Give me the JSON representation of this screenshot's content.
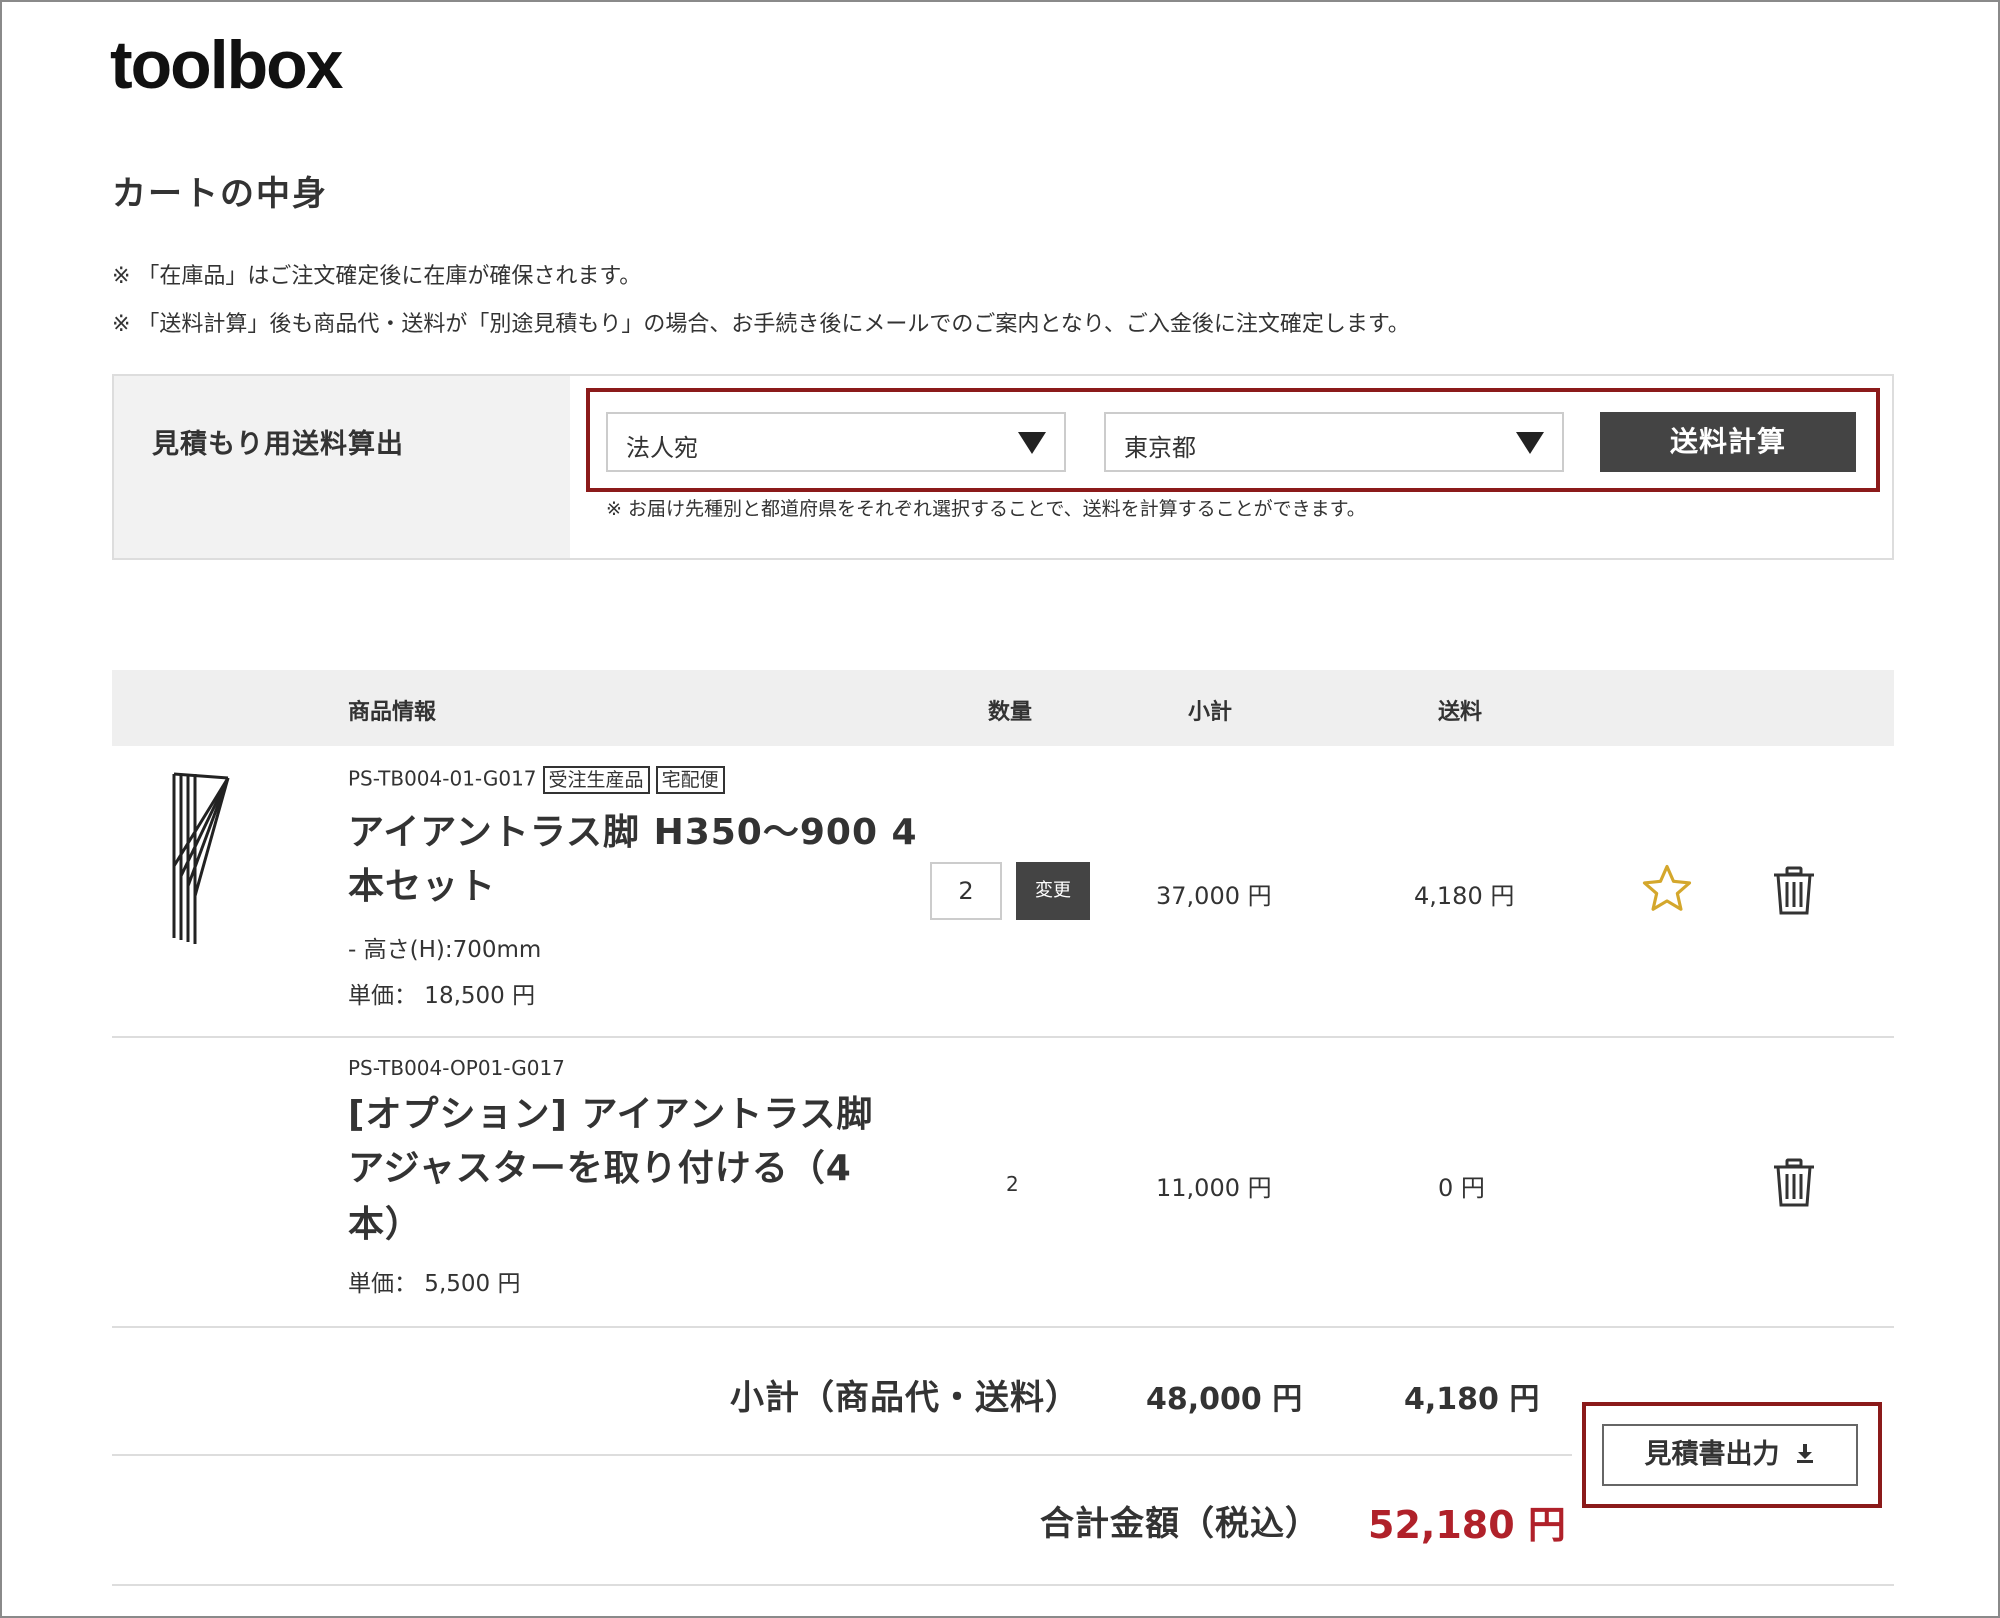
{
  "header": {
    "logo": "toolbox"
  },
  "page": {
    "title": "カートの中身",
    "notes": [
      "※ 「在庫品」はご注文確定後に在庫が確保されます。",
      "※ 「送料計算」後も商品代・送料が「別途見積もり」の場合、お手続き後にメールでのご案内となり、ご入金後に注文確定します。"
    ]
  },
  "shipping": {
    "label": "見積もり用送料算出",
    "destination_type": "法人宛",
    "prefecture": "東京都",
    "calc_button": "送料計算",
    "note": "※ お届け先種別と都道府県をそれぞれ選択することで、送料を計算することができます。"
  },
  "table": {
    "headers": {
      "product": "商品情報",
      "qty": "数量",
      "subtotal": "小計",
      "shipping": "送料"
    }
  },
  "items": [
    {
      "sku": "PS-TB004-01-G017",
      "tags": [
        "受注生産品",
        "宅配便"
      ],
      "name_line1": "アイアントラス脚 H350〜900 4",
      "name_line2": "本セット",
      "option": "-  高さ(H):700mm",
      "unit_price": "単価： 18,500 円",
      "qty": "2",
      "change_label": "変更",
      "subtotal": "37,000 円",
      "shipping": "4,180 円"
    },
    {
      "sku": "PS-TB004-OP01-G017",
      "name_line1": "[オプション] アイアントラス脚",
      "name_line2": "アジャスターを取り付ける（4",
      "name_line3": "本）",
      "unit_price": "単価： 5,500 円",
      "qty": "2",
      "subtotal": "11,000 円",
      "shipping": "0 円"
    }
  ],
  "summary": {
    "subtotal_label": "小計（商品代・送料）",
    "subtotal_goods": "48,000 円",
    "subtotal_shipping": "4,180 円",
    "total_label": "合計金額（税込）",
    "total": "52,180 円",
    "quote_button": "見積書出力"
  },
  "colors": {
    "accent_red": "#b0212a",
    "highlight": "#8b1a1a",
    "dark_button": "#444444",
    "star": "#d4a72c"
  }
}
